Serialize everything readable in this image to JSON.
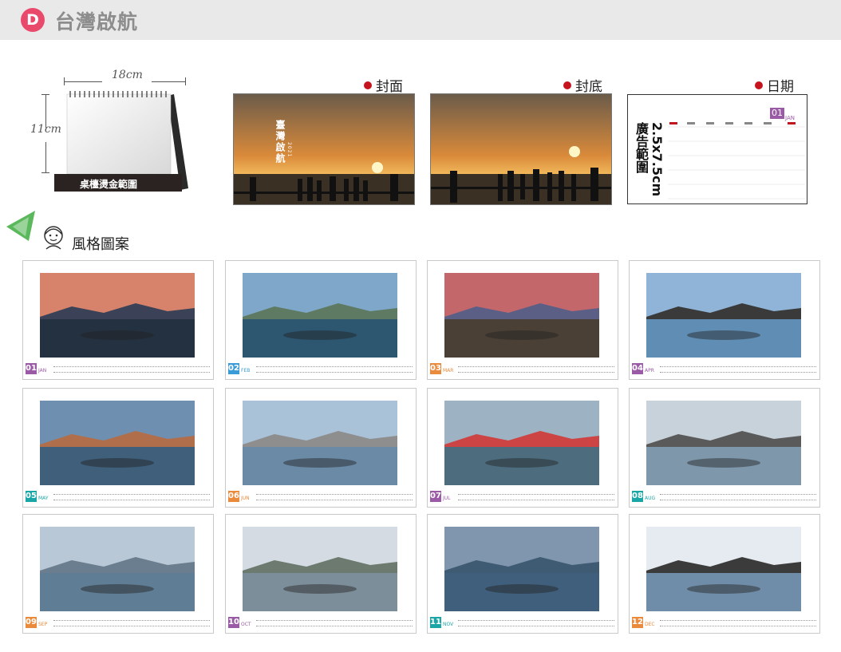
{
  "header": {
    "badge": "D",
    "title": "台灣啟航"
  },
  "product": {
    "width_label": "18cm",
    "height_label": "11cm",
    "base_label": "桌檯燙金範圍"
  },
  "covers": {
    "front_label": "封面",
    "back_label": "封底",
    "date_label": "日期",
    "cover_text": "臺灣啟航",
    "cover_year": "2021"
  },
  "date_page": {
    "ad_text": "2.5x7.5cm廣告範圍",
    "month_num": "01",
    "month_name": "JAN"
  },
  "style_section": {
    "title": "風格圖案"
  },
  "months": [
    {
      "num": "01",
      "name": "JAN",
      "color": "#9b5aa6"
    },
    {
      "num": "02",
      "name": "FEB",
      "color": "#3b9bd6"
    },
    {
      "num": "03",
      "name": "MAR",
      "color": "#e98a3c"
    },
    {
      "num": "04",
      "name": "APR",
      "color": "#9b5aa6"
    },
    {
      "num": "05",
      "name": "MAY",
      "color": "#1aa6a6"
    },
    {
      "num": "06",
      "name": "JUN",
      "color": "#e98a3c"
    },
    {
      "num": "07",
      "name": "JUL",
      "color": "#9b5aa6"
    },
    {
      "num": "08",
      "name": "AUG",
      "color": "#1aa6a6"
    },
    {
      "num": "09",
      "name": "SEP",
      "color": "#e98a3c"
    },
    {
      "num": "10",
      "name": "OCT",
      "color": "#9b5aa6"
    },
    {
      "num": "11",
      "name": "NOV",
      "color": "#1aa6a6"
    },
    {
      "num": "12",
      "name": "DEC",
      "color": "#e98a3c"
    }
  ]
}
